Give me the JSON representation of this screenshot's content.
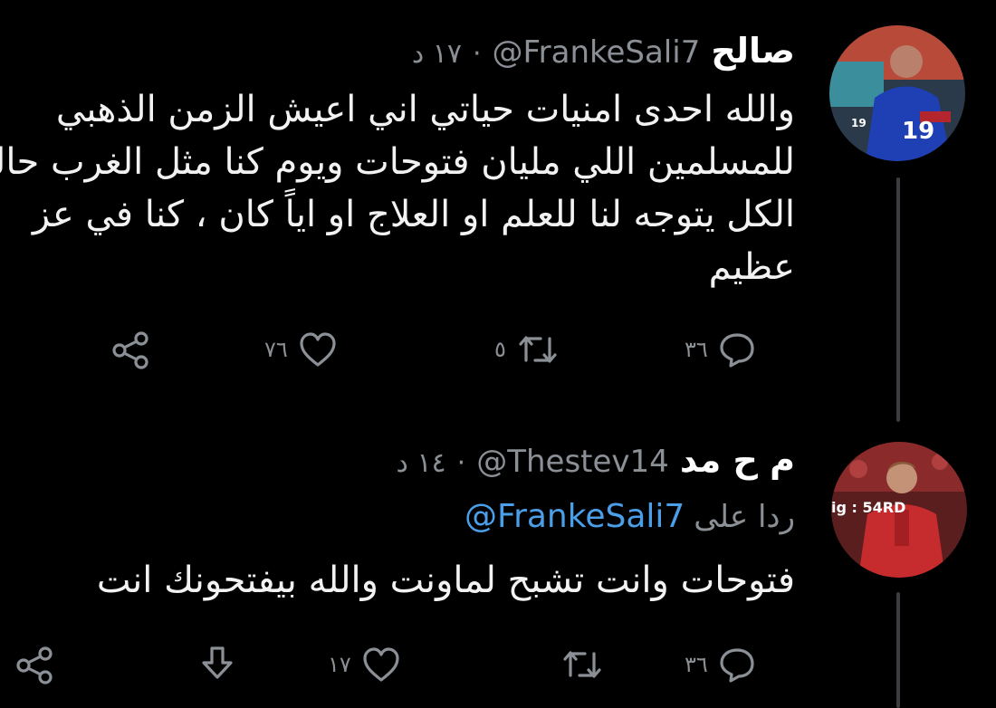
{
  "tweets": [
    {
      "name": "صالح",
      "handle": "@FrankeSali7",
      "separator": "·",
      "time": "١٧ د",
      "lines": [
        "والله احدى امنيات حياتي اني اعيش الزمن الذهبي",
        "للمسلمين اللي مليان فتوحات ويوم كنا مثل الغرب حالياً",
        "الكل يتوجه لنا للعلم او العلاج او اياً كان ، كنا في عز",
        "عظيم"
      ],
      "actions": {
        "reply_count": "٣٦",
        "retweet_count": "٥",
        "like_count": "٧٦"
      }
    },
    {
      "name": "م ح مد",
      "handle": "@Thestev14",
      "separator": "·",
      "time": "١٤ د",
      "reply_label": "ردا على",
      "reply_handle": "@FrankeSali7",
      "lines": [
        "فتوحات وانت تشبح لماونت والله بيفتحونك انت"
      ],
      "avatar_watermark": "ig : 54RD",
      "actions": {
        "reply_count": "٣٦",
        "retweet_count": "",
        "like_count": "١٧"
      }
    }
  ],
  "colors": {
    "background": "#000000",
    "text": "#f2f2f2",
    "muted": "#8b9096",
    "link": "#4a9fe8",
    "thread_line": "#3a3d41"
  },
  "icons": [
    "reply-icon",
    "retweet-icon",
    "like-icon",
    "share-icon",
    "download-icon"
  ]
}
